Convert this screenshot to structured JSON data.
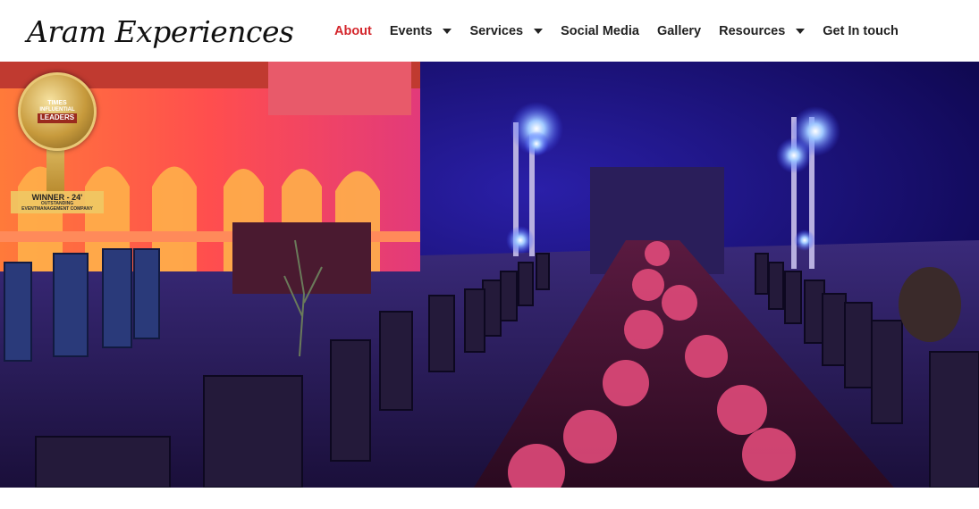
{
  "brand": {
    "logo_text": "Aram Experiences"
  },
  "nav": {
    "items": [
      {
        "label": "About",
        "active": true,
        "has_dropdown": false
      },
      {
        "label": "Events",
        "active": false,
        "has_dropdown": true
      },
      {
        "label": "Services",
        "active": false,
        "has_dropdown": true
      },
      {
        "label": "Social Media",
        "active": false,
        "has_dropdown": false
      },
      {
        "label": "Gallery",
        "active": false,
        "has_dropdown": false
      },
      {
        "label": "Resources",
        "active": false,
        "has_dropdown": true
      },
      {
        "label": "Get In touch",
        "active": false,
        "has_dropdown": false
      }
    ]
  },
  "badge": {
    "line1": "TIMES",
    "line2": "INFLUENTIAL",
    "line3": "LEADERS",
    "winner": "WINNER - 24'",
    "subtitle1": "OUTSTANDING",
    "subtitle2": "EVENTMANAGEMENT COMPANY"
  },
  "colors": {
    "accent": "#d4262c",
    "nav_text": "#222222",
    "hero_bg": "#0a0630"
  }
}
